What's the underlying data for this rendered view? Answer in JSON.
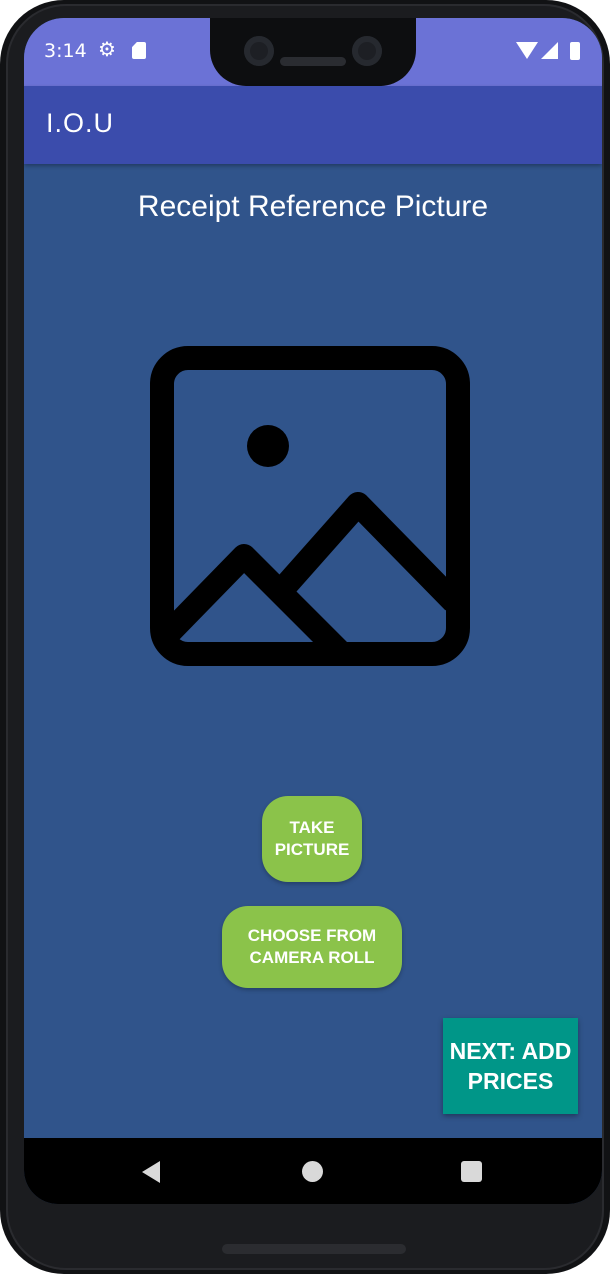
{
  "status_bar": {
    "time": "3:14",
    "icons": [
      "gear-icon",
      "sd-card-icon",
      "wifi-icon",
      "cell-signal-icon",
      "battery-icon"
    ]
  },
  "app_bar": {
    "title": "I.O.U"
  },
  "main": {
    "title": "Receipt Reference Picture",
    "image_placeholder_icon": "image-placeholder-icon",
    "take_picture_label": "TAKE PICTURE",
    "camera_roll_label": "CHOOSE FROM CAMERA ROLL",
    "next_label": "NEXT: ADD PRICES"
  },
  "nav_bar": {
    "icons": [
      "back-icon",
      "home-icon",
      "recents-icon"
    ]
  },
  "colors": {
    "status_bar": "#6b72d6",
    "app_bar": "#3b4cac",
    "background": "#30548b",
    "primary_button": "#8bc34a",
    "next_button": "#009688"
  }
}
